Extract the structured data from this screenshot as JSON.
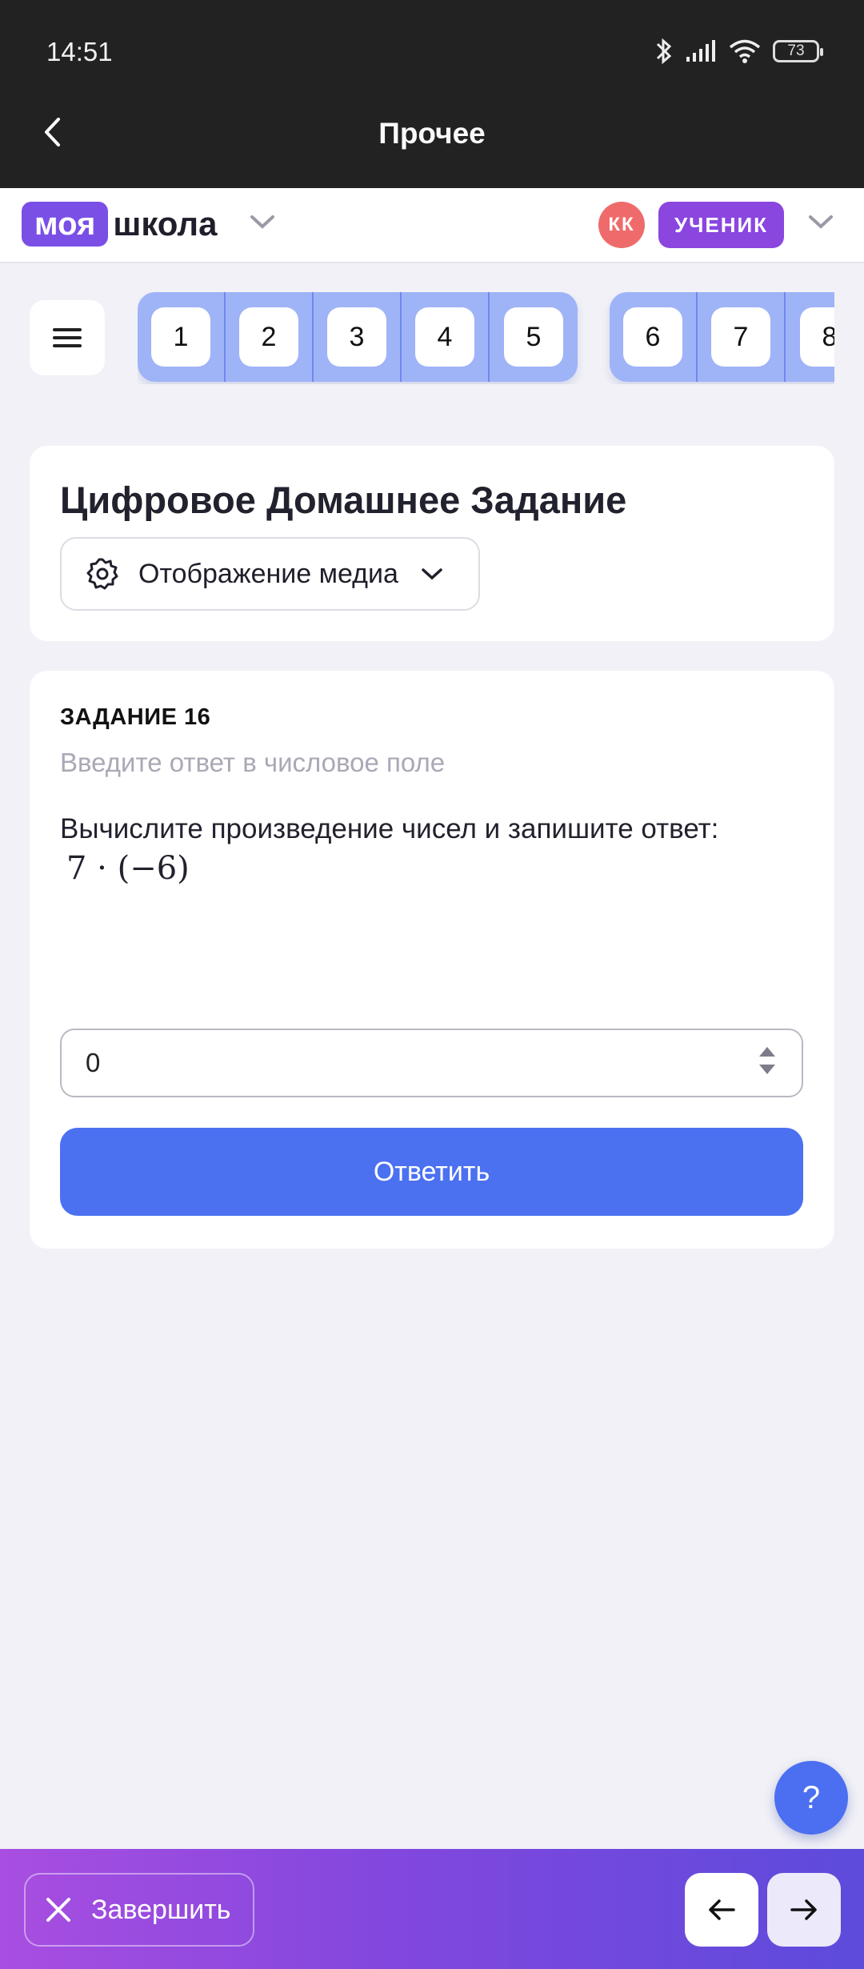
{
  "status_bar": {
    "time": "14:51",
    "battery": "73"
  },
  "app_bar": {
    "title": "Прочее"
  },
  "school": {
    "logo_badge": "моя",
    "logo_text": "школа",
    "avatar_initials": "КК",
    "role": "УЧЕНИК"
  },
  "task_nav": {
    "group1": [
      "1",
      "2",
      "3",
      "4",
      "5"
    ],
    "group2": [
      "6",
      "7",
      "8"
    ]
  },
  "homework": {
    "title": "Цифровое Домашнее Задание",
    "media_label": "Отображение медиа"
  },
  "task": {
    "number": "ЗАДАНИЕ 16",
    "hint": "Введите ответ в числовое поле",
    "question": "Вычислите произведение чисел и запишите ответ:",
    "formula": "7 · (−6)",
    "answer_value": "0",
    "submit_label": "Ответить"
  },
  "help": {
    "label": "?"
  },
  "bottom": {
    "finish_label": "Завершить"
  },
  "colors": {
    "accent": "#4b71f1",
    "brand_purple": "#7a4fe6",
    "role_purple": "#8a46df",
    "avatar_red": "#ef6b6b"
  }
}
